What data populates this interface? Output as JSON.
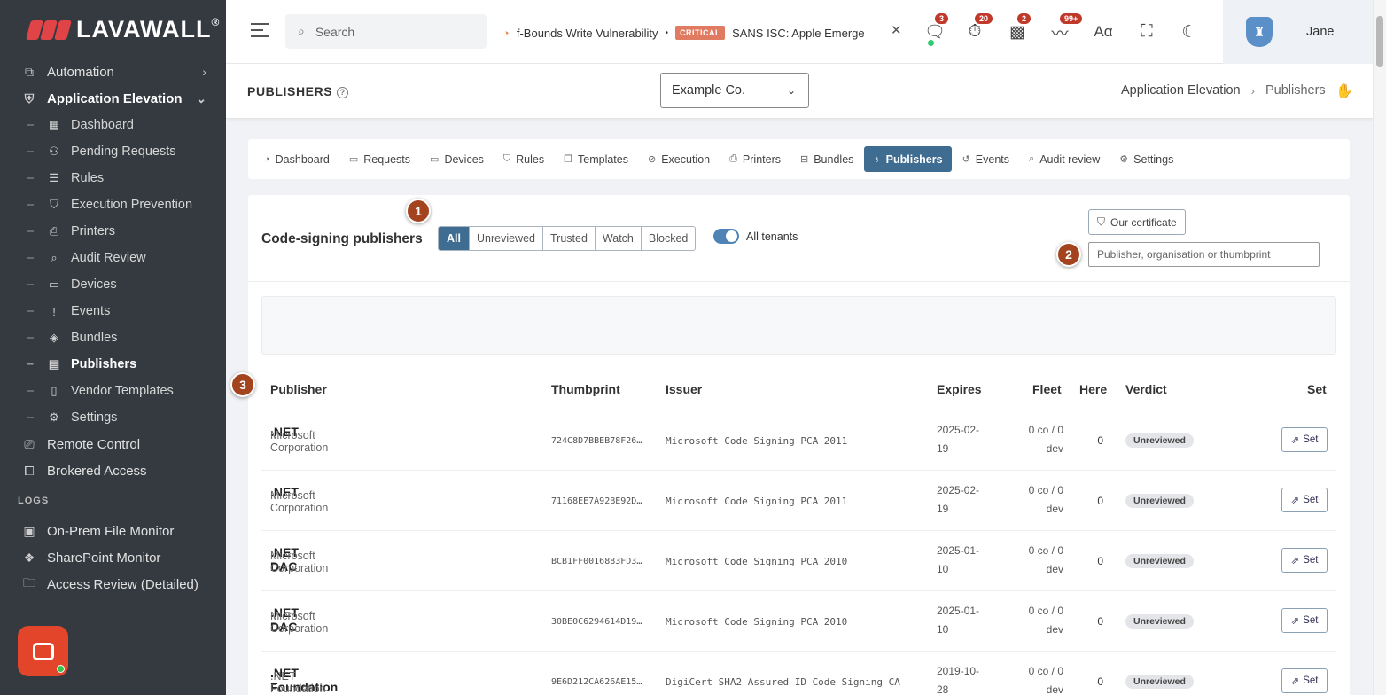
{
  "brand": {
    "name": "LAVAWALL",
    "reg": "®"
  },
  "sidebar": {
    "items": [
      {
        "label": "Automation",
        "icon": "automation-icon"
      },
      {
        "label": "Application Elevation",
        "icon": "shield-icon"
      }
    ],
    "sub_items": [
      {
        "label": "Dashboard",
        "icon": "dashboard-icon"
      },
      {
        "label": "Pending Requests",
        "icon": "pending-requests-icon"
      },
      {
        "label": "Rules",
        "icon": "rules-icon"
      },
      {
        "label": "Execution Prevention",
        "icon": "lock-shield-icon"
      },
      {
        "label": "Printers",
        "icon": "printer-icon"
      },
      {
        "label": "Audit Review",
        "icon": "audit-icon"
      },
      {
        "label": "Devices",
        "icon": "monitor-icon"
      },
      {
        "label": "Events",
        "icon": "alert-shield-icon"
      },
      {
        "label": "Bundles",
        "icon": "box-icon"
      },
      {
        "label": "Publishers",
        "icon": "publisher-icon"
      },
      {
        "label": "Vendor Templates",
        "icon": "document-icon"
      },
      {
        "label": "Settings",
        "icon": "gear-icon"
      }
    ],
    "bottom_items": [
      {
        "label": "Remote Control",
        "icon": "remote-icon"
      },
      {
        "label": "Brokered Access",
        "icon": "brokered-icon"
      }
    ],
    "logs_label": "LOGS",
    "log_items": [
      {
        "label": "On-Prem File Monitor",
        "icon": "file-monitor-icon"
      },
      {
        "label": "SharePoint Monitor",
        "icon": "sharepoint-icon"
      },
      {
        "label": "Access Review (Detailed)",
        "icon": "folder-icon"
      }
    ]
  },
  "topbar": {
    "search_placeholder": "Search",
    "ticker_item1": "f-Bounds Write Vulnerability",
    "ticker_badge": "CRITICAL",
    "ticker_item2": "SANS ISC: Apple Emerge",
    "badges": {
      "messages": "3",
      "timer": "20",
      "qr": "2",
      "feeds": "99+"
    },
    "user_name": "Jane"
  },
  "page": {
    "title": "PUBLISHERS",
    "tenant": "Example Co.",
    "breadcrumb": [
      "Application Elevation",
      "Publishers"
    ]
  },
  "tabs": [
    {
      "label": "Dashboard",
      "icon": "dashboard-icon"
    },
    {
      "label": "Requests",
      "icon": "inbox-icon"
    },
    {
      "label": "Devices",
      "icon": "monitor-icon"
    },
    {
      "label": "Rules",
      "icon": "shield-icon"
    },
    {
      "label": "Templates",
      "icon": "copy-icon"
    },
    {
      "label": "Execution",
      "icon": "check-circle-icon"
    },
    {
      "label": "Printers",
      "icon": "printer-icon"
    },
    {
      "label": "Bundles",
      "icon": "box-icon"
    },
    {
      "label": "Publishers",
      "icon": "publisher-icon",
      "active": true
    },
    {
      "label": "Events",
      "icon": "history-icon"
    },
    {
      "label": "Audit review",
      "icon": "search-icon"
    },
    {
      "label": "Settings",
      "icon": "gear-icon"
    }
  ],
  "card": {
    "title": "Code-signing publishers",
    "filters": [
      "All",
      "Unreviewed",
      "Trusted",
      "Watch",
      "Blocked"
    ],
    "active_filter": "All",
    "toggle_label": "All tenants",
    "cert_button": "Our certificate",
    "filter_placeholder": "Publisher, organisation or thumbprint",
    "markers": [
      "1",
      "2",
      "3"
    ]
  },
  "table": {
    "headers": {
      "publisher": "Publisher",
      "thumbprint": "Thumbprint",
      "issuer": "Issuer",
      "expires": "Expires",
      "fleet": "Fleet",
      "here": "Here",
      "verdict": "Verdict",
      "set": "Set"
    },
    "rows": [
      {
        "name": ".NET",
        "org": "Microsoft Corporation",
        "thumb": "724C8D7BBEB78F26…",
        "issuer": "Microsoft Code Signing PCA 2011",
        "expires_a": "2025-02-",
        "expires_b": "19",
        "fleet_a": "0 co / 0",
        "fleet_b": "dev",
        "here": "0",
        "verdict": "Unreviewed",
        "set": "Set"
      },
      {
        "name": ".NET",
        "org": "Microsoft Corporation",
        "thumb": "71168EE7A92BE92D…",
        "issuer": "Microsoft Code Signing PCA 2011",
        "expires_a": "2025-02-",
        "expires_b": "19",
        "fleet_a": "0 co / 0",
        "fleet_b": "dev",
        "here": "0",
        "verdict": "Unreviewed",
        "set": "Set"
      },
      {
        "name": ".NET DAC",
        "org": "Microsoft Corporation",
        "thumb": "BCB1FF0016883FD3…",
        "issuer": "Microsoft Code Signing PCA 2010",
        "expires_a": "2025-01-",
        "expires_b": "10",
        "fleet_a": "0 co / 0",
        "fleet_b": "dev",
        "here": "0",
        "verdict": "Unreviewed",
        "set": "Set"
      },
      {
        "name": ".NET DAC",
        "org": "Microsoft Corporation",
        "thumb": "30BE0C6294614D19…",
        "issuer": "Microsoft Code Signing PCA 2010",
        "expires_a": "2025-01-",
        "expires_b": "10",
        "fleet_a": "0 co / 0",
        "fleet_b": "dev",
        "here": "0",
        "verdict": "Unreviewed",
        "set": "Set"
      },
      {
        "name": ".NET Foundation",
        "org": ".NET Foundation",
        "thumb": "9E6D212CA626AE15…",
        "issuer": "DigiCert SHA2 Assured ID Code Signing CA",
        "expires_a": "2019-10-",
        "expires_b": "28",
        "fleet_a": "0 co / 0",
        "fleet_b": "dev",
        "here": "0",
        "verdict": "Unreviewed",
        "set": "Set"
      }
    ]
  },
  "colors": {
    "sidebar_bg": "#343a40",
    "accent": "#3f6c91",
    "marker": "#a3441f",
    "chat": "#e3452b",
    "badge": "#c0392b"
  }
}
